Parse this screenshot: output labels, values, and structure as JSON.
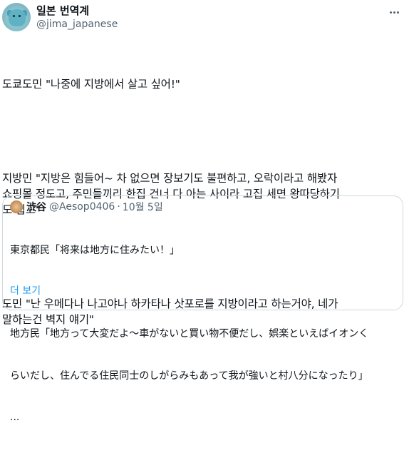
{
  "author": {
    "display_name": "일본 번역계",
    "handle": "@jima_japanese"
  },
  "tweet": {
    "paragraphs": [
      "도쿄도민 \"나중에 지방에서 살고 싶어!\"",
      "지방민 \"지방은 힘들어~ 차 없으면 장보기도 불편하고, 오락이라고 해봤자\n쇼핑몰 정도고, 주민들끼리 한집 건너 다 아는 사이라 고집 세면 왕따당하기\n도 쉽고\"",
      "도민 \"난 우메다나 나고야나 하카타나 삿포로를 지방이라고 하는거야, 네가\n말하는건 벽지 얘기\""
    ]
  },
  "quote": {
    "display_name": "渋谷",
    "handle": "@Aesop0406",
    "separator": "·",
    "date": "10월 5일",
    "lines": [
      "東京都民「将来は地方に住みたい！」",
      "",
      "地方民「地方って大変だよ～車がないと買い物不便だし、娯楽といえばイオンく",
      "らいだし、住んでる住民同士のしがらみもあって我が強いと村八分になったり」",
      "..."
    ],
    "show_more": "더 보기"
  },
  "icons": {
    "more": "more-horizontal-icon"
  }
}
